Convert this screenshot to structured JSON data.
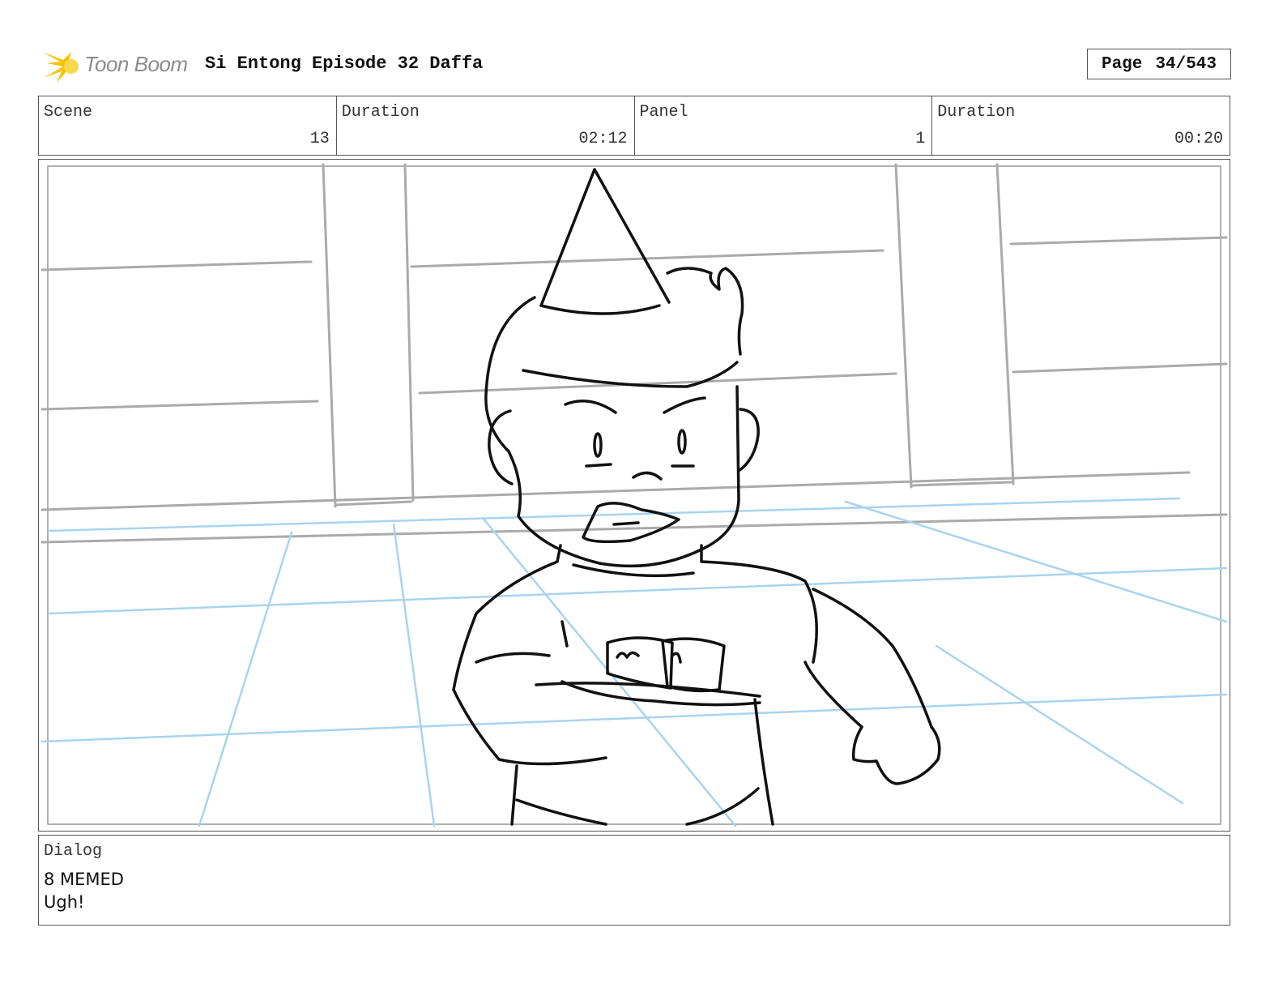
{
  "header": {
    "logo_text": "Toon Boom",
    "title": "Si Entong Episode 32 Daffa",
    "page_label": "Page",
    "page_value": "34/543"
  },
  "info": {
    "scene_label": "Scene",
    "scene_value": "13",
    "scene_duration_label": "Duration",
    "scene_duration_value": "02:12",
    "panel_label": "Panel",
    "panel_value": "1",
    "panel_duration_label": "Duration",
    "panel_duration_value": "00:20"
  },
  "panel": {
    "sketch_icon": "boy-with-party-hat-holding-plate-sketch",
    "colors": {
      "ink": "#111111",
      "background_lines": "#aaaaaa",
      "floor_guides": "#a8d4ee"
    }
  },
  "dialog": {
    "label": "Dialog",
    "line1": "8 MEMED",
    "line2": "Ugh!"
  }
}
